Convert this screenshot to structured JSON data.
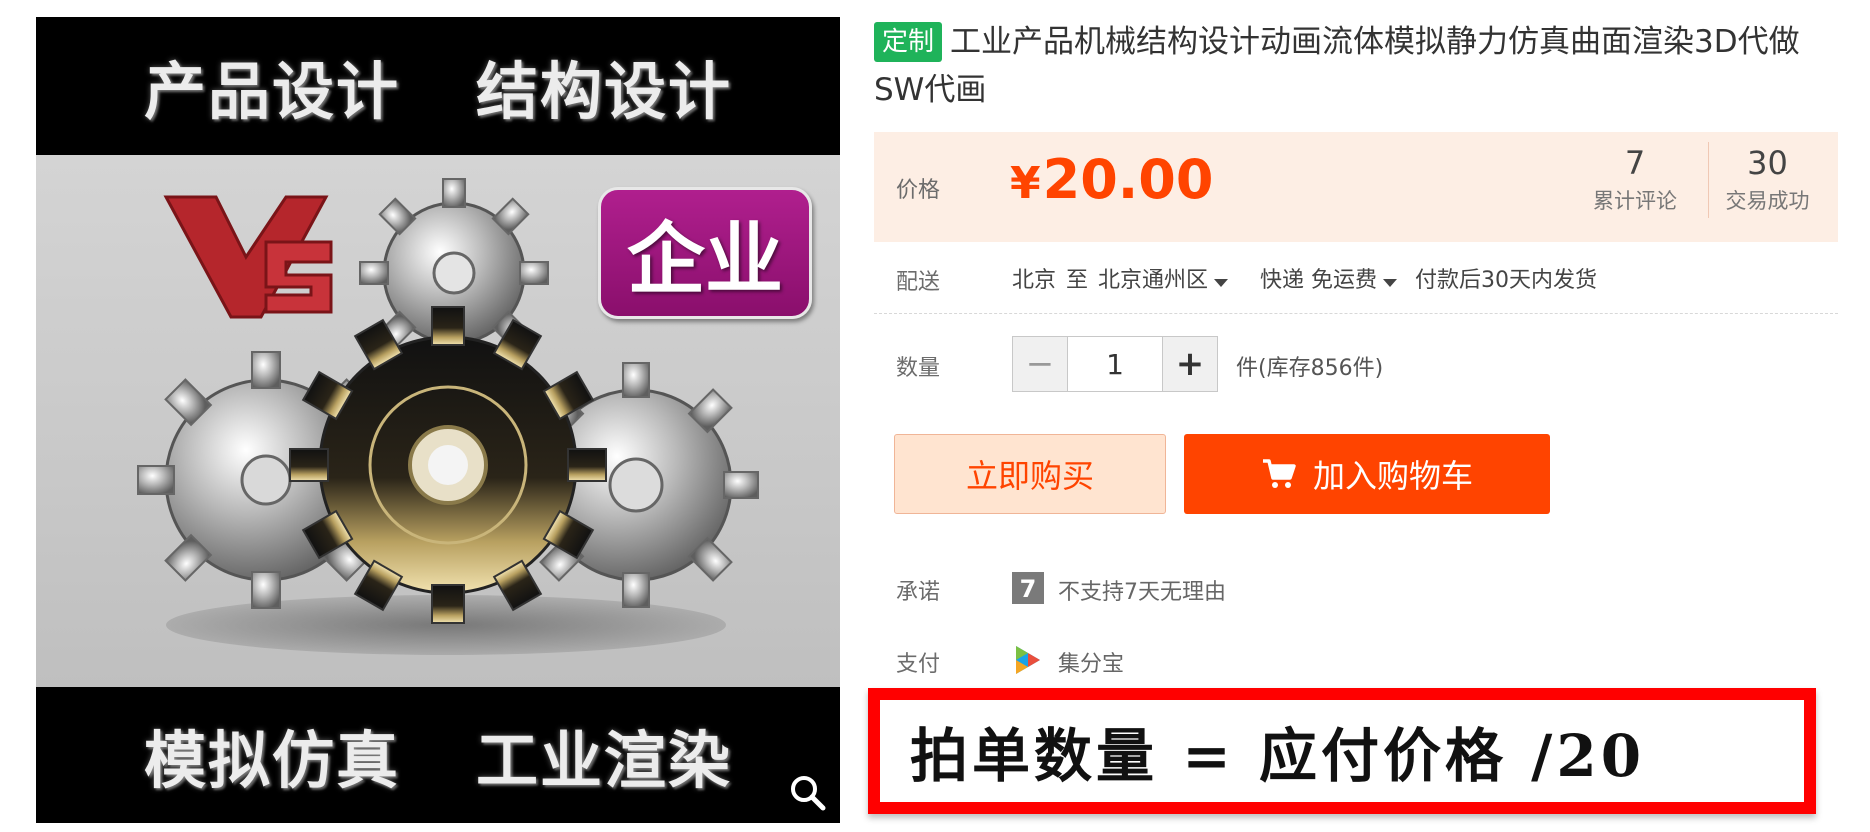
{
  "product_image": {
    "top_left_text": "产品设计",
    "top_right_text": "结构设计",
    "bottom_left_text": "模拟仿真",
    "bottom_right_text": "工业渲染",
    "badge_text": "企业",
    "icon_zoom": "zoom-icon"
  },
  "product": {
    "tag": "定制",
    "title": "工业产品机械结构设计动画流体模拟静力仿真曲面渲染3D代做SW代画"
  },
  "price": {
    "label": "价格",
    "currency": "¥",
    "amount": "20.00",
    "reviews_count": "7",
    "reviews_label": "累计评论",
    "deals_count": "30",
    "deals_label": "交易成功"
  },
  "delivery": {
    "label": "配送",
    "from": "北京",
    "to_word": "至",
    "destination": "北京通州区",
    "shipping": "快递 免运费",
    "dispatch": "付款后30天内发货"
  },
  "quantity": {
    "label": "数量",
    "minus": "−",
    "value": "1",
    "plus": "+",
    "stock": "件(库存856件)"
  },
  "buttons": {
    "buy_now": "立即购买",
    "add_to_cart": "加入购物车",
    "cart_icon": "cart-icon"
  },
  "promise": {
    "label": "承诺",
    "icon_text": "7",
    "text": "不支持7天无理由"
  },
  "payment": {
    "label": "支付",
    "method": "集分宝"
  },
  "note": {
    "text": "拍单数量 = 应付价格 /20"
  },
  "colors": {
    "price": "#ff4400",
    "tag": "#1fb35a",
    "price_panel": "#fdeee4",
    "note_border": "#ff0000",
    "badge": "#9c1580"
  }
}
